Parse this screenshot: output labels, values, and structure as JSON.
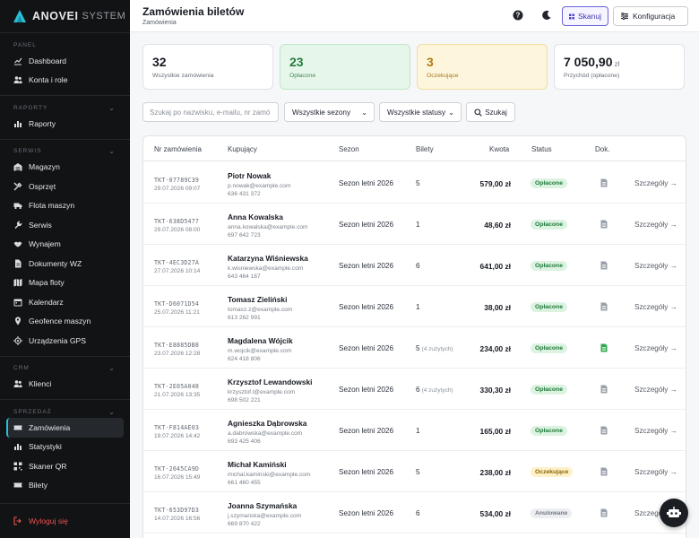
{
  "brand": {
    "name": "ANOVEI",
    "sub": "SYSTEM"
  },
  "sidebar": {
    "sections": [
      {
        "title": "PANEL",
        "items": [
          {
            "label": "Dashboard",
            "icon": "chart-line-icon"
          },
          {
            "label": "Konta i role",
            "icon": "users-icon"
          }
        ]
      },
      {
        "title": "RAPORTY",
        "items": [
          {
            "label": "Raporty",
            "icon": "chart-bar-icon"
          }
        ]
      },
      {
        "title": "SERWIS",
        "items": [
          {
            "label": "Magazyn",
            "icon": "warehouse-icon"
          },
          {
            "label": "Osprzęt",
            "icon": "tools-icon"
          },
          {
            "label": "Flota maszyn",
            "icon": "truck-icon"
          },
          {
            "label": "Serwis",
            "icon": "wrench-icon"
          },
          {
            "label": "Wynajem",
            "icon": "handshake-icon"
          },
          {
            "label": "Dokumenty WZ",
            "icon": "document-icon"
          },
          {
            "label": "Mapa floty",
            "icon": "map-icon"
          },
          {
            "label": "Kalendarz",
            "icon": "calendar-icon"
          },
          {
            "label": "Geofence maszyn",
            "icon": "geofence-icon"
          },
          {
            "label": "Urządzenia GPS",
            "icon": "gps-icon"
          }
        ]
      },
      {
        "title": "CRM",
        "items": [
          {
            "label": "Klienci",
            "icon": "users-icon"
          }
        ]
      },
      {
        "title": "SPRZEDAŻ",
        "items": [
          {
            "label": "Zamówienia",
            "icon": "ticket-icon",
            "active": true
          },
          {
            "label": "Statystyki",
            "icon": "chart-bar-icon"
          },
          {
            "label": "Skaner QR",
            "icon": "qr-icon"
          },
          {
            "label": "Bilety",
            "icon": "ticket-icon"
          }
        ]
      }
    ],
    "logout": "Wyloguj się"
  },
  "header": {
    "title": "Zamówienia biletów",
    "breadcrumb": "Zamówienia",
    "scan_label": "Skanuj",
    "config_label": "Konfiguracja"
  },
  "stats": {
    "all": {
      "value": "32",
      "label": "Wszystkie zamówienia"
    },
    "paid": {
      "value": "23",
      "label": "Opłacone"
    },
    "pending": {
      "value": "3",
      "label": "Oczekujące"
    },
    "revenue": {
      "value": "7 050,90",
      "unit": "zł",
      "label": "Przychód (opłacone)"
    }
  },
  "filters": {
    "search_placeholder": "Szukaj po nazwisku, e-mailu, nr zamó",
    "season": "Wszystkie sezony",
    "status": "Wszystkie statusy",
    "search_button": "Szukaj"
  },
  "table": {
    "headers": [
      "Nr zamówienia",
      "Kupujący",
      "Sezon",
      "Bilety",
      "Kwota",
      "Status",
      "Dok."
    ],
    "rows": [
      {
        "id": "TKT-07789C39",
        "date": "29.07.2026 09:07",
        "name": "Piotr Nowak",
        "email": "p.nowak@example.com",
        "phone": "636 431 372",
        "season": "Sezon letni 2026",
        "tickets": "5",
        "used": "",
        "amount": "579,00 zł",
        "status": "Opłacone",
        "status_kind": "paid",
        "doc_color": "#9aa0a8",
        "details": "Szczegóły →"
      },
      {
        "id": "TKT-638D5477",
        "date": "29.07.2026 08:00",
        "name": "Anna Kowalska",
        "email": "anna.kowalska@example.com",
        "phone": "697 642 723",
        "season": "Sezon letni 2026",
        "tickets": "1",
        "used": "",
        "amount": "48,60 zł",
        "status": "Opłacone",
        "status_kind": "paid",
        "doc_color": "#9aa0a8",
        "details": "Szczegóły →"
      },
      {
        "id": "TKT-4EC3D27A",
        "date": "27.07.2026 10:14",
        "name": "Katarzyna Wiśniewska",
        "email": "k.wisniewska@example.com",
        "phone": "643 464 167",
        "season": "Sezon letni 2026",
        "tickets": "6",
        "used": "",
        "amount": "641,00 zł",
        "status": "Opłacone",
        "status_kind": "paid",
        "doc_color": "#9aa0a8",
        "details": "Szczegóły →"
      },
      {
        "id": "TKT-D6071D54",
        "date": "25.07.2026 11:21",
        "name": "Tomasz Zieliński",
        "email": "tomasz.z@example.com",
        "phone": "613 262 991",
        "season": "Sezon letni 2026",
        "tickets": "1",
        "used": "",
        "amount": "38,00 zł",
        "status": "Opłacone",
        "status_kind": "paid",
        "doc_color": "#9aa0a8",
        "details": "Szczegóły →"
      },
      {
        "id": "TKT-E8885DB8",
        "date": "23.07.2026 12:28",
        "name": "Magdalena Wójcik",
        "email": "m.wojcik@example.com",
        "phone": "624 418 806",
        "season": "Sezon letni 2026",
        "tickets": "5",
        "used": "(4 zużytych)",
        "amount": "234,00 zł",
        "status": "Opłacone",
        "status_kind": "paid",
        "doc_color": "#2fa84f",
        "details": "Szczegóły →"
      },
      {
        "id": "TKT-2E05A048",
        "date": "21.07.2026 13:35",
        "name": "Krzysztof Lewandowski",
        "email": "krzysztof.l@example.com",
        "phone": "698 502 221",
        "season": "Sezon letni 2026",
        "tickets": "6",
        "used": "(4 zużytych)",
        "amount": "330,30 zł",
        "status": "Opłacone",
        "status_kind": "paid",
        "doc_color": "#9aa0a8",
        "details": "Szczegóły →"
      },
      {
        "id": "TKT-F814AE03",
        "date": "19.07.2026 14:42",
        "name": "Agnieszka Dąbrowska",
        "email": "a.dabrowska@example.com",
        "phone": "693 425 406",
        "season": "Sezon letni 2026",
        "tickets": "1",
        "used": "",
        "amount": "165,00 zł",
        "status": "Opłacone",
        "status_kind": "paid",
        "doc_color": "#9aa0a8",
        "details": "Szczegóły →"
      },
      {
        "id": "TKT-2645CA9D",
        "date": "16.07.2026 15:49",
        "name": "Michał Kamiński",
        "email": "michal.kaminski@example.com",
        "phone": "661 460 455",
        "season": "Sezon letni 2026",
        "tickets": "5",
        "used": "",
        "amount": "238,00 zł",
        "status": "Oczekujące",
        "status_kind": "pend",
        "doc_color": "#9aa0a8",
        "details": "Szczegóły →"
      },
      {
        "id": "TKT-653D97D3",
        "date": "14.07.2026 16:56",
        "name": "Joanna Szymańska",
        "email": "j.szymanska@example.com",
        "phone": "669 870 422",
        "season": "Sezon letni 2026",
        "tickets": "6",
        "used": "",
        "amount": "534,00 zł",
        "status": "Anulowane",
        "status_kind": "canc",
        "doc_color": "#9aa0a8",
        "details": "Szczegóły →"
      }
    ]
  },
  "colors": {
    "accent": "#27c0d8",
    "paid": "#227d3b",
    "pending": "#b07d0c",
    "danger": "#ef5350",
    "scan": "#6c63d8"
  }
}
